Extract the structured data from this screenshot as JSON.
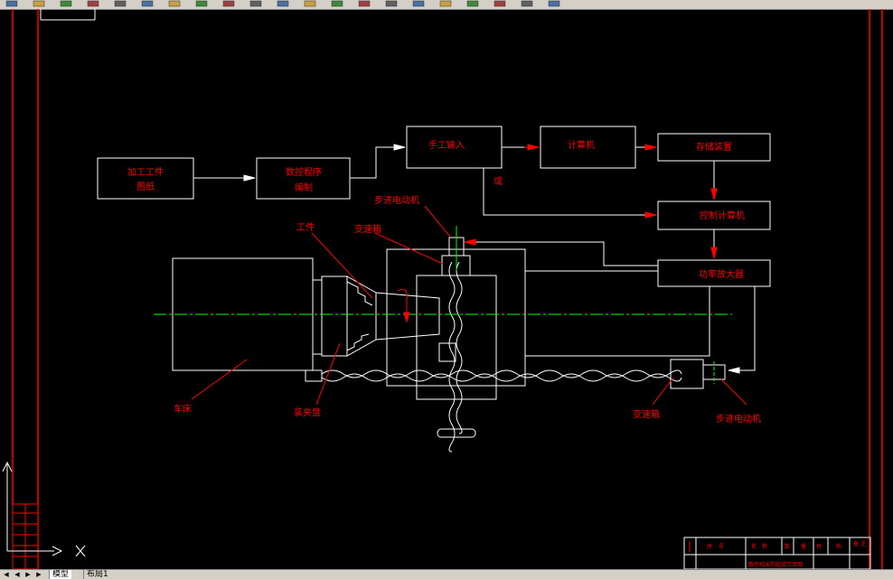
{
  "app": {
    "type": "AutoCAD-style drawing",
    "background_color": "#000000",
    "line_color": "#ffffff",
    "label_color": "#ff0000",
    "centerline_color": "#00ff00"
  },
  "toolbar": {
    "icons": [
      "new-icon",
      "open-icon",
      "save-icon",
      "print-icon",
      "preview-icon",
      "cut-icon",
      "copy-icon",
      "paste-icon",
      "match-icon",
      "undo-icon",
      "redo-icon",
      "pan-icon",
      "zoom-icon",
      "zoom-window-icon",
      "zoom-previous-icon",
      "properties-icon",
      "design-center-icon",
      "tool-palette-icon",
      "calculator-icon",
      "layer-icon",
      "color-icon"
    ]
  },
  "diagram": {
    "blocks": {
      "drawing": {
        "line1": "加工工件",
        "line2": "图纸"
      },
      "programming": {
        "line1": "数控程序",
        "line2": "编制"
      },
      "manual_input": "手工输入",
      "computer": "计算机",
      "storage": "存储装置",
      "control_computer": "控制计算机",
      "power_amplifier": "功率放大器"
    },
    "labels": {
      "or": "或",
      "stepper_motor_top": "步进电动机",
      "workpiece": "工件",
      "gearbox_top": "变速箱",
      "bed": "车床",
      "chuck": "装夹盘",
      "gearbox_bottom": "变速箱",
      "stepper_motor_bottom": "步进电动机"
    }
  },
  "title_block": {
    "row1": [
      "序",
      "号",
      "名",
      "称",
      "数",
      "量",
      "材",
      "料",
      "备",
      "注"
    ],
    "row2_note": "数控机床的组成示意图"
  },
  "tabs": {
    "model": "模型",
    "layout1": "布局1"
  }
}
